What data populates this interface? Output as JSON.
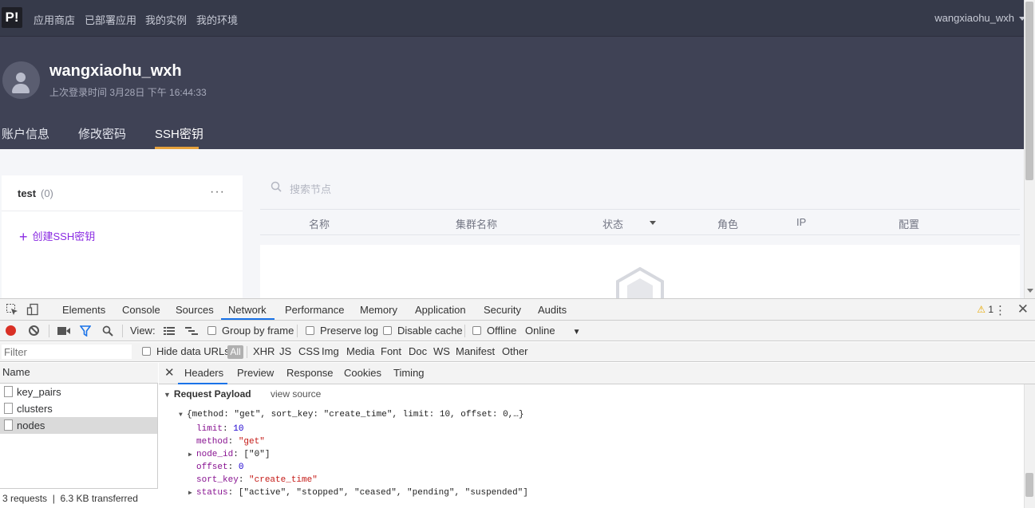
{
  "topnav": {
    "logo": "P!",
    "links": [
      "应用商店",
      "已部署应用",
      "我的实例",
      "我的环境"
    ],
    "user": "wangxiaohu_wxh"
  },
  "profile": {
    "username": "wangxiaohu_wxh",
    "last_login": "上次登录时间 3月28日 下午 16:44:33",
    "tabs": [
      "账户信息",
      "修改密码",
      "SSH密钥"
    ],
    "active_tab": "SSH密钥"
  },
  "keys": {
    "name": "test",
    "count": "(0)",
    "more": "···",
    "create_label": "创建SSH密钥"
  },
  "nodes": {
    "search_placeholder": "搜索节点",
    "columns": [
      "名称",
      "集群名称",
      "状态",
      "角色",
      "IP",
      "配置"
    ]
  },
  "devtools": {
    "tabs": [
      "Elements",
      "Console",
      "Sources",
      "Network",
      "Performance",
      "Memory",
      "Application",
      "Security",
      "Audits"
    ],
    "active_tab": "Network",
    "warnings": "1",
    "toolbar": {
      "view_label": "View:",
      "group_by_frame": "Group by frame",
      "preserve_log": "Preserve log",
      "disable_cache": "Disable cache",
      "offline": "Offline",
      "throttle": "Online"
    },
    "filter": {
      "placeholder": "Filter",
      "hide_data_urls": "Hide data URLs",
      "types": [
        "All",
        "XHR",
        "JS",
        "CSS",
        "Img",
        "Media",
        "Font",
        "Doc",
        "WS",
        "Manifest",
        "Other"
      ]
    },
    "requests": {
      "header": "Name",
      "items": [
        "key_pairs",
        "clusters",
        "nodes"
      ],
      "selected": "nodes",
      "summary": "3 requests  |  6.3 KB transferred"
    },
    "detail": {
      "tabs": [
        "Headers",
        "Preview",
        "Response",
        "Cookies",
        "Timing"
      ],
      "active_tab": "Headers",
      "section_title": "Request Payload",
      "view_source": "view source",
      "summary_line": "{method: \"get\", sort_key: \"create_time\", limit: 10, offset: 0,…}",
      "fields": [
        {
          "key": "limit",
          "value": "10",
          "type": "number",
          "expandable": false
        },
        {
          "key": "method",
          "value": "\"get\"",
          "type": "string",
          "expandable": false
        },
        {
          "key": "node_id",
          "value": "[\"0\"]",
          "type": "plain",
          "expandable": true
        },
        {
          "key": "offset",
          "value": "0",
          "type": "number",
          "expandable": false
        },
        {
          "key": "sort_key",
          "value": "\"create_time\"",
          "type": "string",
          "expandable": false
        },
        {
          "key": "status",
          "value": "[\"active\", \"stopped\", \"ceased\", \"pending\", \"suspended\"]",
          "type": "plain",
          "expandable": true
        }
      ]
    }
  }
}
